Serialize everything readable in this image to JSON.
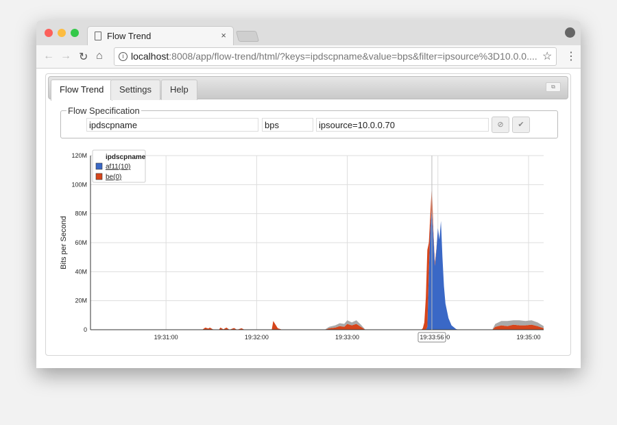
{
  "browser": {
    "tab_title": "Flow Trend",
    "tab_close": "×",
    "url_host": "localhost",
    "url_rest": ":8008/app/flow-trend/html/?keys=ipdscpname&value=bps&filter=ipsource%3D10.0.0....",
    "icons": [
      "back-icon",
      "forward-icon",
      "reload-icon",
      "home-icon",
      "info-icon",
      "star-icon",
      "menu-icon",
      "profile-icon"
    ]
  },
  "app": {
    "tabs": [
      {
        "label": "Flow Trend",
        "active": true
      },
      {
        "label": "Settings",
        "active": false
      },
      {
        "label": "Help",
        "active": false
      }
    ],
    "flow_spec": {
      "legend": "Flow Specification",
      "keys": "ipdscpname",
      "value": "bps",
      "filter": "ipsource=10.0.0.70"
    }
  },
  "chart_data": {
    "type": "area",
    "stacked": true,
    "ylabel": "Bits per Second",
    "xlabel": "",
    "ylim": [
      0,
      120000000
    ],
    "xlim": [
      "19:30:10",
      "19:35:10"
    ],
    "y_ticks": [
      "0",
      "20M",
      "40M",
      "60M",
      "80M",
      "100M",
      "120M"
    ],
    "x_ticks": [
      "19:31:00",
      "19:32:00",
      "19:33:00",
      "19:34:00",
      "19:35:00"
    ],
    "grid": true,
    "legend_title": "ipdscpname",
    "legend_position": "top-left",
    "cursor_time": "19:33:56",
    "x": [
      "19:30:10",
      "19:31:24",
      "19:31:26",
      "19:31:28",
      "19:31:29",
      "19:31:31",
      "19:31:35",
      "19:31:36",
      "19:31:38",
      "19:31:40",
      "19:31:42",
      "19:31:45",
      "19:31:47",
      "19:31:50",
      "19:31:52",
      "19:32:10",
      "19:32:11",
      "19:32:14",
      "19:32:17",
      "19:32:45",
      "19:32:48",
      "19:32:52",
      "19:32:55",
      "19:32:58",
      "19:33:00",
      "19:33:03",
      "19:33:06",
      "19:33:09",
      "19:33:12",
      "19:33:49",
      "19:33:50",
      "19:33:51",
      "19:33:52",
      "19:33:53",
      "19:33:54",
      "19:33:55",
      "19:33:56",
      "19:33:57",
      "19:33:58",
      "19:33:59",
      "19:34:00",
      "19:34:01",
      "19:34:02",
      "19:34:03",
      "19:34:04",
      "19:34:05",
      "19:34:07",
      "19:34:09",
      "19:34:12",
      "19:34:14",
      "19:34:36",
      "19:34:38",
      "19:34:42",
      "19:34:46",
      "19:34:50",
      "19:34:54",
      "19:34:58",
      "19:35:02",
      "19:35:06",
      "19:35:10"
    ],
    "series": [
      {
        "name": "af11(10)",
        "color": "#3a68c6",
        "values": [
          0,
          0,
          0,
          0,
          0,
          0,
          0,
          0,
          0,
          0,
          0,
          0,
          0,
          0,
          0,
          0,
          0,
          0,
          0,
          0,
          0,
          0,
          0,
          0,
          0,
          0,
          0,
          0,
          0,
          0,
          0,
          0,
          0,
          2000000,
          40000000,
          70000000,
          86000000,
          65000000,
          44000000,
          55000000,
          70000000,
          62000000,
          75000000,
          50000000,
          30000000,
          18000000,
          8000000,
          3000000,
          500000,
          0,
          0,
          0,
          0,
          0,
          0,
          0,
          0,
          0,
          0,
          0
        ]
      },
      {
        "name": "be(0)",
        "color": "#d6451b",
        "values": [
          0,
          0,
          1500000,
          800000,
          1500000,
          300000,
          0,
          1500000,
          300000,
          1500000,
          0,
          1200000,
          0,
          1000000,
          0,
          0,
          6000000,
          1000000,
          0,
          0,
          1000000,
          1500000,
          2500000,
          2000000,
          4000000,
          3000000,
          4000000,
          2000000,
          0,
          0,
          1000000,
          5000000,
          22000000,
          53000000,
          20000000,
          10000000,
          14000000,
          3000000,
          2000000,
          1000000,
          0,
          0,
          0,
          0,
          0,
          0,
          0,
          0,
          0,
          0,
          0,
          2000000,
          3000000,
          2500000,
          3500000,
          3000000,
          3000000,
          3500000,
          2500000,
          1000000
        ]
      },
      {
        "color": "#a9a9a9",
        "values": [
          0,
          0,
          0,
          0,
          0,
          0,
          0,
          0,
          0,
          0,
          0,
          0,
          0,
          0,
          0,
          0,
          0,
          0,
          0,
          0,
          1000000,
          1500000,
          2000000,
          2000000,
          2500000,
          2000000,
          2500000,
          1500000,
          0,
          0,
          0,
          0,
          0,
          0,
          0,
          0,
          0,
          0,
          0,
          0,
          0,
          0,
          0,
          0,
          0,
          0,
          0,
          0,
          0,
          0,
          0,
          2000000,
          3000000,
          3500000,
          3000000,
          3500000,
          3000000,
          3000000,
          2500000,
          1500000
        ]
      }
    ]
  }
}
